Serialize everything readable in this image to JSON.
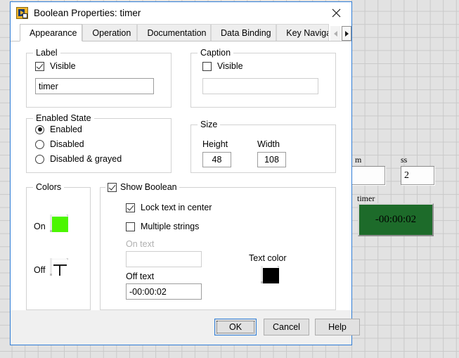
{
  "background_panel": {
    "labels": [
      {
        "name": "mm-label",
        "text": "m"
      },
      {
        "name": "ss-label",
        "text": "ss"
      },
      {
        "name": "timer-label",
        "text": "timer"
      }
    ],
    "mm_value": "",
    "ss_value": "2",
    "boolean_indicator": {
      "label": "timer",
      "text": "-00:00:02",
      "background_color": "#1d6b2a",
      "text_color": "#000000"
    }
  },
  "dialog": {
    "title": "Boolean Properties: timer",
    "icon_name": "labview-boolean-icon",
    "close_label": "✕",
    "tabs": [
      {
        "label": "Appearance",
        "active": true
      },
      {
        "label": "Operation",
        "active": false
      },
      {
        "label": "Documentation",
        "active": false
      },
      {
        "label": "Data Binding",
        "active": false
      },
      {
        "label": "Key Naviga",
        "active": false
      }
    ],
    "tab_scroll_left": "◀",
    "tab_scroll_right": "▶",
    "label_group": {
      "title": "Label",
      "visible_label": "Visible",
      "visible_checked": true,
      "text_value": "timer"
    },
    "caption_group": {
      "title": "Caption",
      "visible_label": "Visible",
      "visible_checked": false,
      "text_value": ""
    },
    "enabled_state_group": {
      "title": "Enabled State",
      "options": [
        {
          "label": "Enabled",
          "selected": true
        },
        {
          "label": "Disabled",
          "selected": false
        },
        {
          "label": "Disabled & grayed",
          "selected": false
        }
      ]
    },
    "size_group": {
      "title": "Size",
      "height_label": "Height",
      "height_value": "48",
      "width_label": "Width",
      "width_value": "108"
    },
    "colors_group": {
      "title": "Colors",
      "on_label": "On",
      "on_color": "#4CF600",
      "off_label": "Off",
      "off_color": "transparent"
    },
    "boolean_group": {
      "title": "Show Boolean",
      "show_boolean_checked": true,
      "lock_text_label": "Lock text in center",
      "lock_text_checked": true,
      "multiple_strings_label": "Multiple strings",
      "multiple_strings_checked": false,
      "on_text_label": "On text",
      "on_text_value": "",
      "off_text_label": "Off text",
      "off_text_value": "-00:00:02",
      "text_color_label": "Text color",
      "text_color_value": "#000000"
    },
    "buttons": {
      "ok": "OK",
      "cancel": "Cancel",
      "help": "Help"
    }
  }
}
